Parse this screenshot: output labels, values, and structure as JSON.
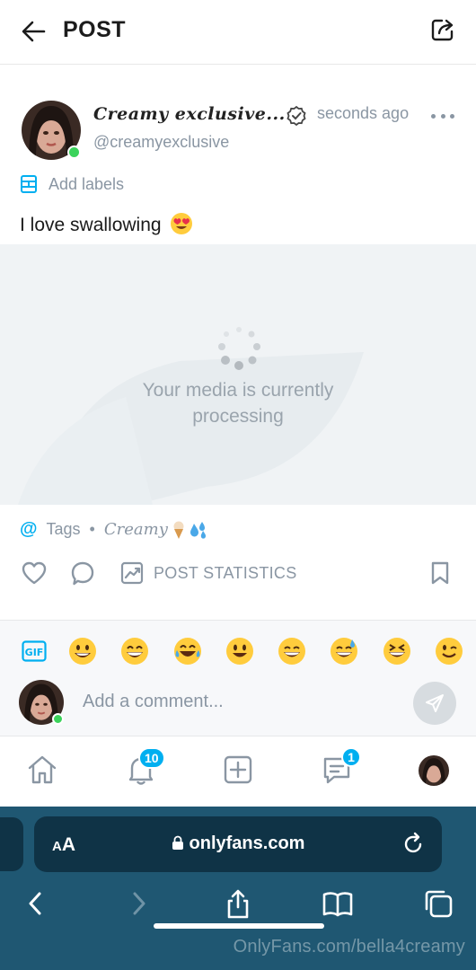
{
  "header": {
    "title": "POST"
  },
  "post": {
    "author_display_name": "Creamy exclusive...",
    "author_username": "@creamyexclusive",
    "time": "seconds ago",
    "labels_text": "Add labels",
    "text": "I love swallowing",
    "media_status_line1": "Your media is currently",
    "media_status_line2": "processing",
    "tags_label": "Tags",
    "tags_separator": "•",
    "tag_value": "Creamy",
    "stats_label": "POST STATISTICS"
  },
  "composer": {
    "gif_label": "GIF",
    "placeholder": "Add a comment..."
  },
  "nav": {
    "notifications_badge": "10",
    "messages_badge": "1"
  },
  "browser": {
    "aa_small": "A",
    "aa_big": "A",
    "url": "onlyfans.com"
  },
  "watermark": "OnlyFans.com/bella4creamy",
  "colors": {
    "accent": "#00aff0",
    "muted": "#8a96a3",
    "online": "#3bd35b",
    "safari_bar": "#1f5772",
    "urlbar": "#0f3346"
  }
}
